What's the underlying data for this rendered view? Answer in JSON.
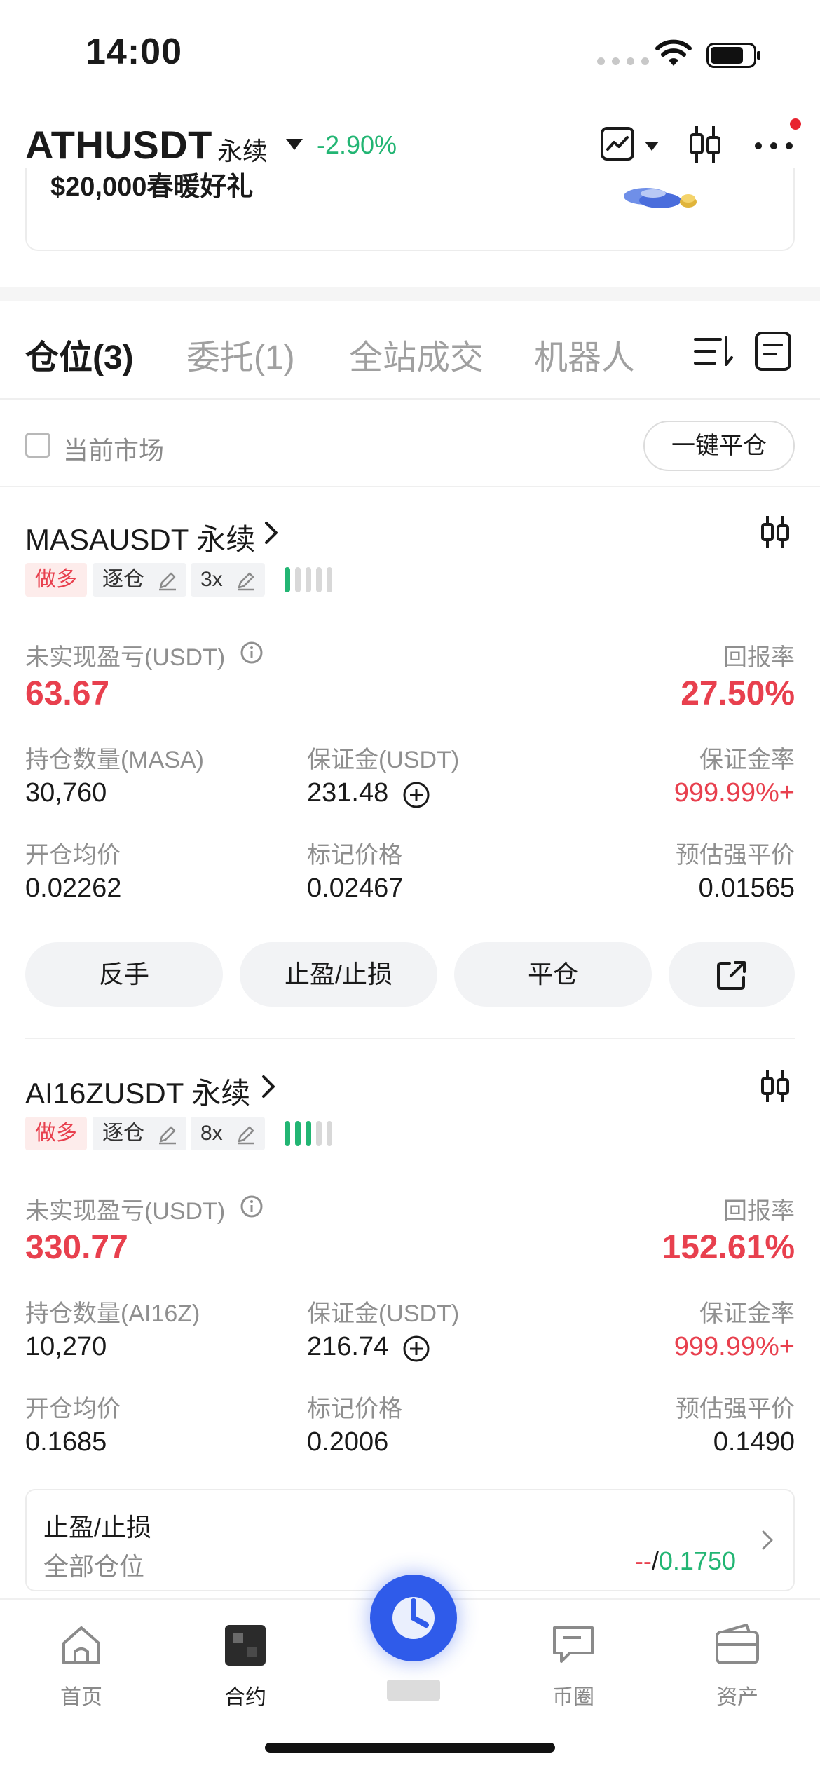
{
  "status_bar": {
    "time": "14:00"
  },
  "header": {
    "symbol": "ATHUSDT",
    "contract_type": "永续",
    "change": "-2.90%",
    "icons": [
      "trend-chart-icon",
      "candlestick-icon",
      "more-icon"
    ]
  },
  "banner": {
    "text": "$20,000春暖好礼"
  },
  "tabs": [
    {
      "label": "仓位(3)",
      "active": true
    },
    {
      "label": "委托(1)",
      "active": false
    },
    {
      "label": "全站成交",
      "active": false
    },
    {
      "label": "机器人",
      "active": false
    }
  ],
  "filter": {
    "label": "当前市场",
    "close_all": "一键平仓"
  },
  "labels": {
    "unrealized_pnl": "未实现盈亏(USDT)",
    "roe": "回报率",
    "margin": "保证金(USDT)",
    "margin_ratio": "保证金率",
    "entry_price": "开仓均价",
    "mark_price": "标记价格",
    "liq_price": "预估强平价"
  },
  "positions": [
    {
      "title": "MASAUSDT 永续",
      "side": "做多",
      "mode": "逐仓",
      "leverage": "3x",
      "risk_level": 1,
      "pnl": "63.67",
      "roe": "27.50%",
      "qty_label": "持仓数量(MASA)",
      "qty": "30,760",
      "margin": "231.48",
      "margin_ratio": "999.99%+",
      "entry": "0.02262",
      "mark": "0.02467",
      "liq": "0.01565",
      "buttons": [
        "反手",
        "止盈/止损",
        "平仓"
      ]
    },
    {
      "title": "AI16ZUSDT 永续",
      "side": "做多",
      "mode": "逐仓",
      "leverage": "8x",
      "risk_level": 3,
      "pnl": "330.77",
      "roe": "152.61%",
      "qty_label": "持仓数量(AI16Z)",
      "qty": "10,270",
      "margin": "216.74",
      "margin_ratio": "999.99%+",
      "entry": "0.1685",
      "mark": "0.2006",
      "liq": "0.1490",
      "tpsl": {
        "title": "止盈/止损",
        "scope": "全部仓位",
        "tp": "--",
        "sep": "/",
        "sl": "0.1750"
      }
    }
  ],
  "bottom_nav": [
    {
      "label": "首页",
      "icon": "home-icon"
    },
    {
      "label": "合约",
      "icon": "contract-icon",
      "active": true
    },
    {
      "label": "",
      "icon": "trade-center-icon"
    },
    {
      "label": "币圈",
      "icon": "community-icon"
    },
    {
      "label": "资产",
      "icon": "wallet-icon"
    }
  ],
  "colors": {
    "green": "#22b573",
    "red": "#e8404e",
    "accent": "#2f5bea"
  }
}
